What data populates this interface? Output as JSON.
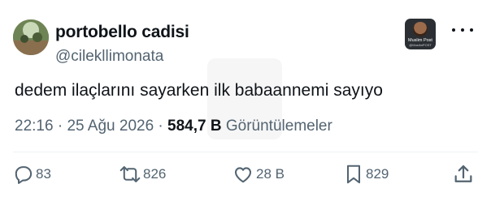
{
  "tweet": {
    "author": {
      "display_name": "portobello cadisi",
      "handle": "@cilekllimonata"
    },
    "badge": {
      "line1": "Muslim Post",
      "line2": "@MuslimPOST"
    },
    "text": "dedem ilaçlarını sayarken ilk babaannemi sayıyo",
    "meta": {
      "time": "22:16",
      "separator": " · ",
      "date": "25 Ağu 2026",
      "separator2": " · ",
      "views_count": "584,7 B",
      "views_label": " Görüntülemeler"
    },
    "actions": {
      "replies": "83",
      "retweets": "826",
      "likes": "28 B",
      "bookmarks": "829"
    }
  },
  "colors": {
    "text_primary": "#0f1419",
    "text_secondary": "#536471",
    "divider": "#eff3f4"
  },
  "icons": {
    "reply": "reply-icon",
    "retweet": "retweet-icon",
    "like": "like-icon",
    "bookmark": "bookmark-icon",
    "share": "share-icon",
    "more": "more-icon"
  }
}
